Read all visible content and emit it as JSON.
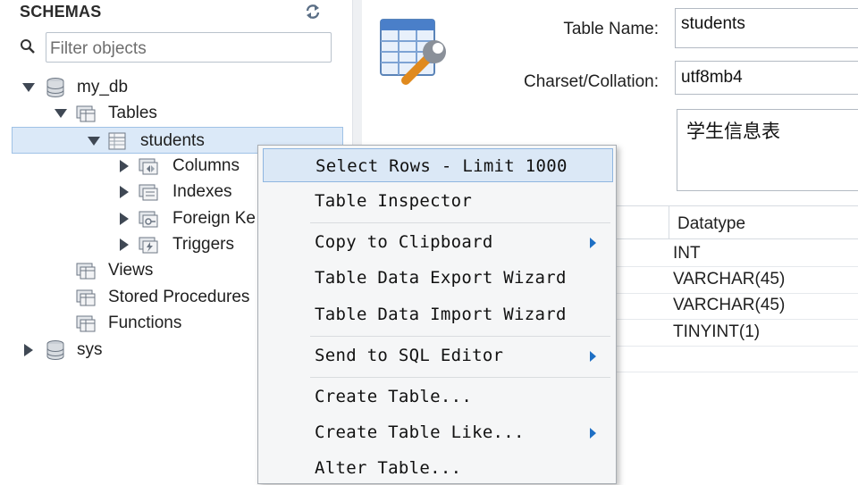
{
  "sidebar": {
    "title": "SCHEMAS",
    "filter_placeholder": "Filter objects",
    "tree": {
      "db1": "my_db",
      "tables": "Tables",
      "students": "students",
      "columns": "Columns",
      "indexes": "Indexes",
      "foreign_keys": "Foreign Ke",
      "triggers": "Triggers",
      "views": "Views",
      "stored_procedures": "Stored Procedures",
      "functions": "Functions",
      "db2": "sys"
    }
  },
  "editor": {
    "table_name_label": "Table Name:",
    "table_name_value": "students",
    "charset_label": "Charset/Collation:",
    "charset_value": "utf8mb4",
    "comment_value": "学生信息表",
    "columns_header": "Datatype",
    "datatypes": [
      "INT",
      "VARCHAR(45)",
      "VARCHAR(45)",
      "TINYINT(1)"
    ]
  },
  "context_menu": {
    "items": [
      {
        "label": "Select Rows - Limit 1000",
        "submenu": false,
        "highlighted": true
      },
      {
        "label": "Table Inspector",
        "submenu": false
      },
      {
        "label": "Copy to Clipboard",
        "submenu": true
      },
      {
        "label": "Table Data Export Wizard",
        "submenu": false
      },
      {
        "label": "Table Data Import Wizard",
        "submenu": false
      },
      {
        "label": "Send to SQL Editor",
        "submenu": true
      },
      {
        "label": "Create Table...",
        "submenu": false
      },
      {
        "label": "Create Table Like...",
        "submenu": true
      },
      {
        "label": "Alter Table...",
        "submenu": false
      }
    ]
  },
  "colors": {
    "selection_bg": "#dbe9f8",
    "menu_bg": "#f5f6f7",
    "submenu_arrow": "#1e6fc4"
  }
}
